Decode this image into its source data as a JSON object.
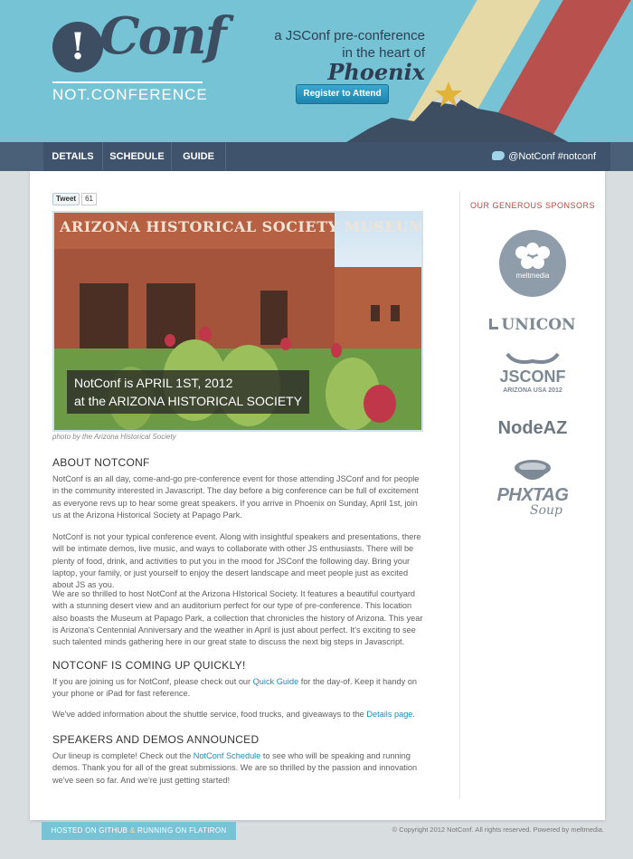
{
  "header": {
    "logo_badge": "!",
    "logo_word": "Conf",
    "logo_sub": "NOT.CONFERENCE",
    "tagline_line1": "a JSConf pre-conference",
    "tagline_line2": "in the heart of",
    "tagline_city": "Phoenix",
    "register_label": "Register to Attend"
  },
  "nav": {
    "items": [
      "DETAILS",
      "SCHEDULE",
      "GUIDE"
    ],
    "social": "@NotConf  #notconf"
  },
  "tweet": {
    "label": "Tweet",
    "count": "61"
  },
  "hero": {
    "sign": "ARIZONA HISTORICAL SOCIETY MUSEUM",
    "caption_line1": "NotConf is APRIL 1ST, 2012",
    "caption_line2": "at the ARIZONA HISTORICAL SOCIETY",
    "credit": "photo by the Arizona Historical Society"
  },
  "about": {
    "title": "ABOUT NOTCONF",
    "p1": "NotConf is an all day, come-and-go pre-conference event for those attending JSConf and for people in the community interested in Javascript. The day before a big conference can be full of excitement as everyone revs up to hear some great speakers. If you arrive in Phoenix on Sunday, April 1st, join us at the Arizona Historical Society at Papago Park.",
    "p2": "NotConf is not your typical conference event. Along with insightful speakers and presentations, there will be intimate demos, live music, and ways to collaborate with other JS enthusiasts. There will be plenty of food, drink, and activities to put you in the mood for JSConf the following day. Bring your laptop, your family, or just yourself to enjoy the desert landscape and meet people just as excited about JS as you.",
    "p3": "We are so thrilled to host NotConf at the Arizona HIstorical Society. It features a beautiful courtyard with a stunning desert view and an auditorium perfect for our type of pre-conference. This location also boasts the Museum at Papago Park, a collection that chronicles the history of Arizona. This year is Arizona's Centennial Anniversary and the weather in April is just about perfect. It's exciting to see such talented minds gathering here in our great state to discuss the next big steps in Javascript."
  },
  "coming": {
    "title": "NOTCONF IS COMING UP QUICKLY!",
    "p1_a": "If you are joining us for NotConf, please check out our ",
    "p1_link": "Quick Guide",
    "p1_b": " for the day-of. Keep it handy on your phone or iPad for fast reference.",
    "p2_a": "We've added information about the shuttle service, food trucks, and giveaways to the ",
    "p2_link": "Details page",
    "p2_b": "."
  },
  "speakers": {
    "title": "SPEAKERS AND DEMOS ANNOUNCED",
    "p1_a": "Our lineup is complete! Check out the ",
    "p1_link": "NotConf Schedule",
    "p1_b": " to see who will be speaking and running demos. Thank you for all of the great submissions. We are so thrilled by the passion and innovation we've seen so far. And we're just getting started!"
  },
  "sidebar": {
    "title": "OUR GENEROUS SPONSORS",
    "sponsors": [
      "meltmedia",
      "UNICON",
      "JSCONF",
      "ARIZONA  USA  2012",
      "NodeAZ",
      "PHXTAG",
      "Soup"
    ]
  },
  "footer": {
    "hosted": "HOSTED ON GITHUB",
    "amp": "&",
    "running": "RUNNING ON FLATIRON",
    "copyright": "© Copyright 2012 NotConf. All rights reserved. Powered by meltmedia."
  },
  "colors": {
    "header_bg": "#76c3d6",
    "nav_bg": "#3f546c",
    "accent_link": "#1f8bb3",
    "sponsor_title": "#b14b42"
  }
}
